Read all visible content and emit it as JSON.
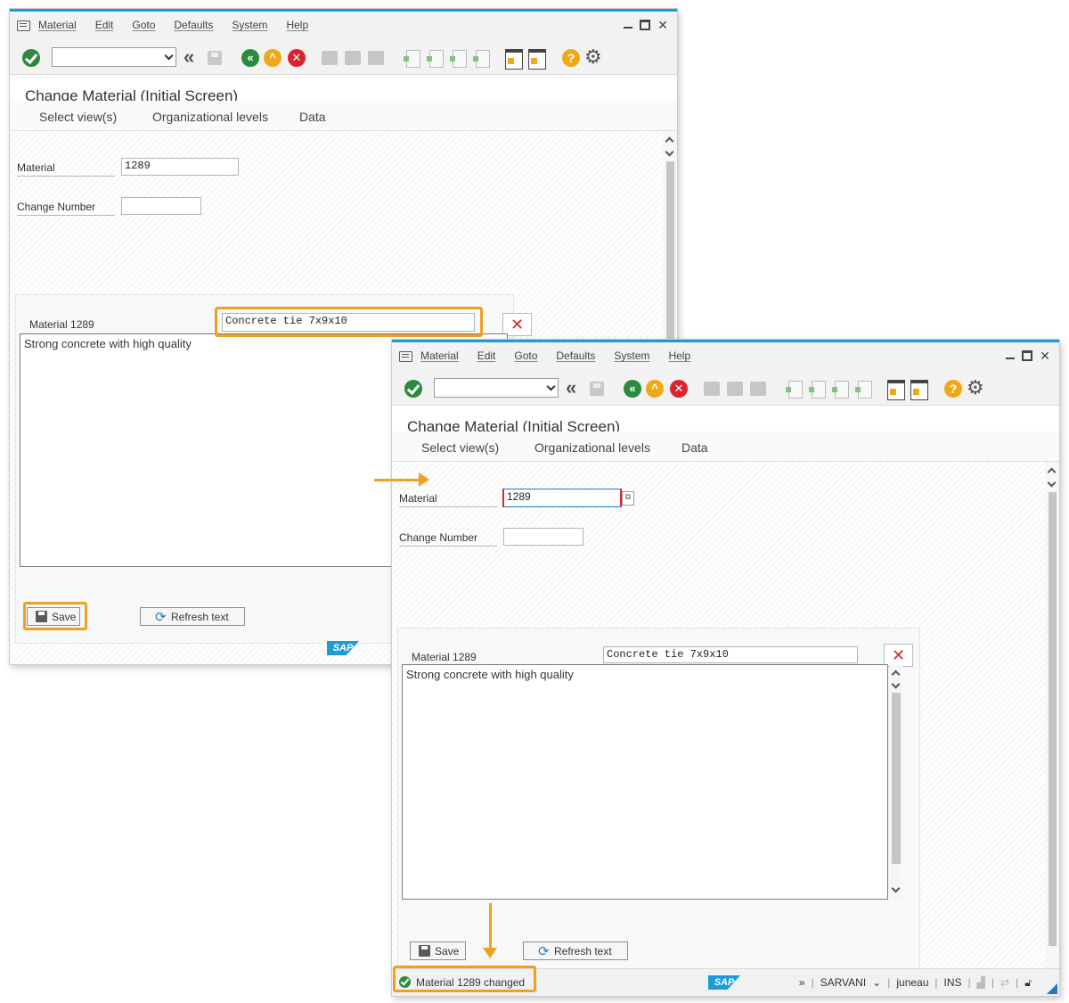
{
  "menu": [
    "Material",
    "Edit",
    "Goto",
    "Defaults",
    "System",
    "Help"
  ],
  "screen_title": "Change Material (Initial Screen)",
  "tabs": [
    "Select view(s)",
    "Organizational levels",
    "Data"
  ],
  "form": {
    "material_label": "Material",
    "material_value": "1289",
    "change_number_label": "Change Number",
    "change_number_value": ""
  },
  "text_panel": {
    "header_label": "Material 1289",
    "description_value": "Concrete tie 7x9x10",
    "long_text": "Strong concrete with high quality",
    "save_label": "Save",
    "refresh_label": "Refresh text"
  },
  "status": {
    "message": "Material 1289 changed",
    "system": "SARVANI",
    "client": "juneau",
    "mode": "INS"
  },
  "logo_text": "SAP",
  "accent_color": "#1e9bd7",
  "highlight_color": "#f0a020"
}
